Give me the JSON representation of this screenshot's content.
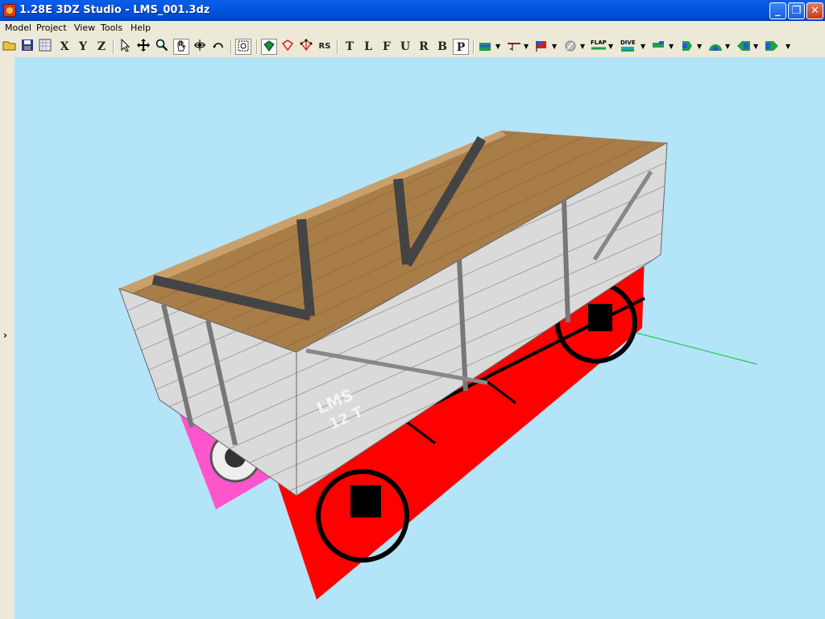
{
  "window": {
    "title": "1.28E 3DZ Studio - LMS_001.3dz"
  },
  "caption_buttons": {
    "minimize": "_",
    "maximize": "❐",
    "close": "✕"
  },
  "menu": [
    {
      "label": "Model"
    },
    {
      "label": "Project"
    },
    {
      "label": "View"
    },
    {
      "label": "Tools"
    },
    {
      "label": "Help"
    }
  ],
  "toolbar": {
    "axis_x": "X",
    "axis_y": "Y",
    "axis_z": "Z",
    "rs_label": "RS",
    "view_top": "T",
    "view_left": "L",
    "view_front": "F",
    "view_up": "U",
    "view_right": "R",
    "view_back": "B",
    "view_perspective": "P",
    "flap_label": "FLAP",
    "dive_label": "DIVE"
  },
  "dock": {
    "arrow": "›"
  },
  "scene": {
    "wagon_marking_line1": "LMS",
    "wagon_marking_line2": "12 T",
    "colors": {
      "background": "#b4e4f8",
      "floor": "#a97d48",
      "sides": "#d9d9d9",
      "red_plane": "#ff0000",
      "pink_plane": "#ff55cc",
      "axis_green": "#22cc55"
    }
  }
}
